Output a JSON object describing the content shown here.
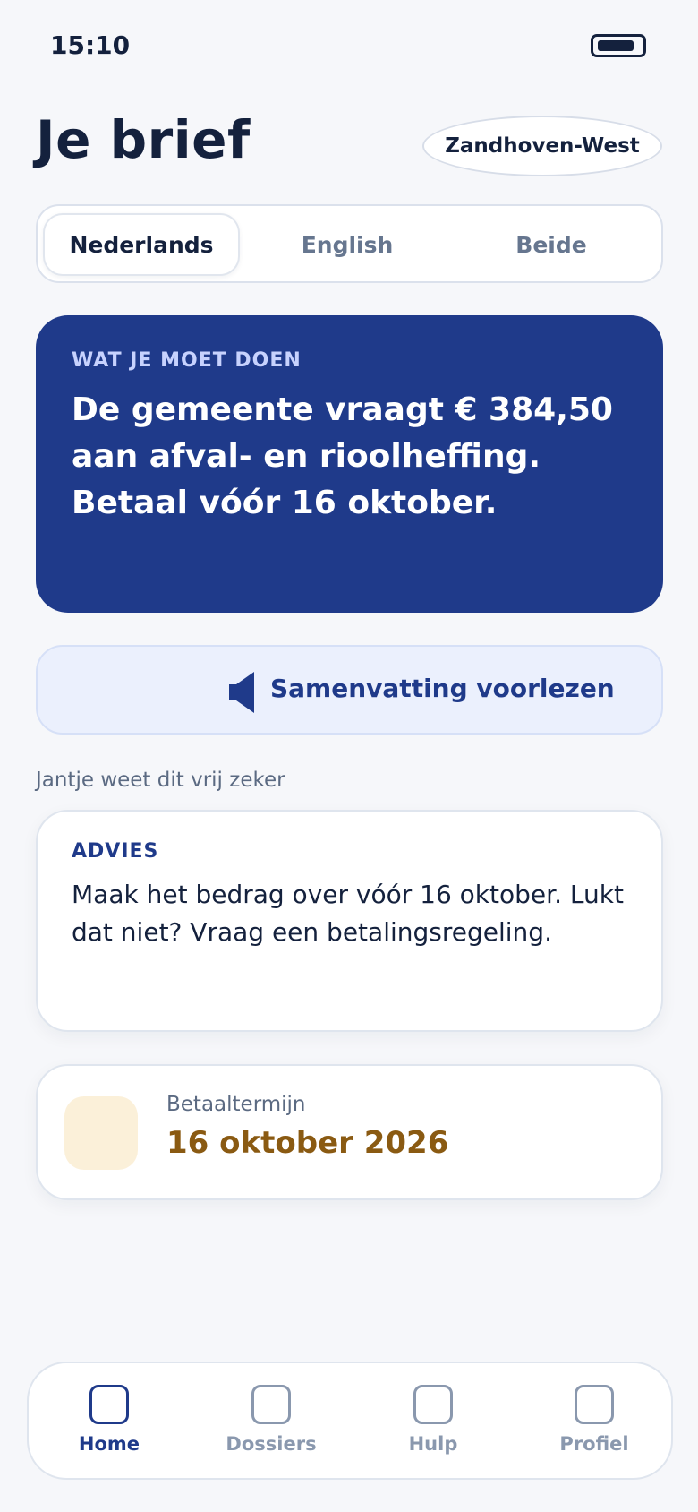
{
  "status_bar": {
    "time": "15:10"
  },
  "header": {
    "title": "Je brief",
    "region": "Zandhoven-West"
  },
  "language_tabs": [
    {
      "label": "Nederlands",
      "active": true
    },
    {
      "label": "English",
      "active": false
    },
    {
      "label": "Beide",
      "active": false
    }
  ],
  "action_card": {
    "kicker": "WAT JE MOET DOEN",
    "text": "De gemeente vraagt € 384,50 aan afval- en rioolheffing. Betaal vóór 16 oktober."
  },
  "read_aloud": {
    "label": "Samenvatting voorlezen",
    "icon": "speaker-icon"
  },
  "confidence": "Jantje weet dit vrij zeker",
  "advice": {
    "kicker": "ADVIES",
    "text": "Maak het bedrag over vóór 16 oktober. Lukt dat niet? Vraag een betalingsregeling."
  },
  "deadline": {
    "label": "Betaaltermijn",
    "value": "16 oktober 2026"
  },
  "nav": [
    {
      "label": "Home",
      "active": true
    },
    {
      "label": "Dossiers",
      "active": false
    },
    {
      "label": "Hulp",
      "active": false
    },
    {
      "label": "Profiel",
      "active": false
    }
  ],
  "colors": {
    "primary": "#1f3a8a",
    "background": "#f6f7fa",
    "deadline_accent": "#8a5a12",
    "deadline_icon_bg": "#fbf0d9"
  }
}
